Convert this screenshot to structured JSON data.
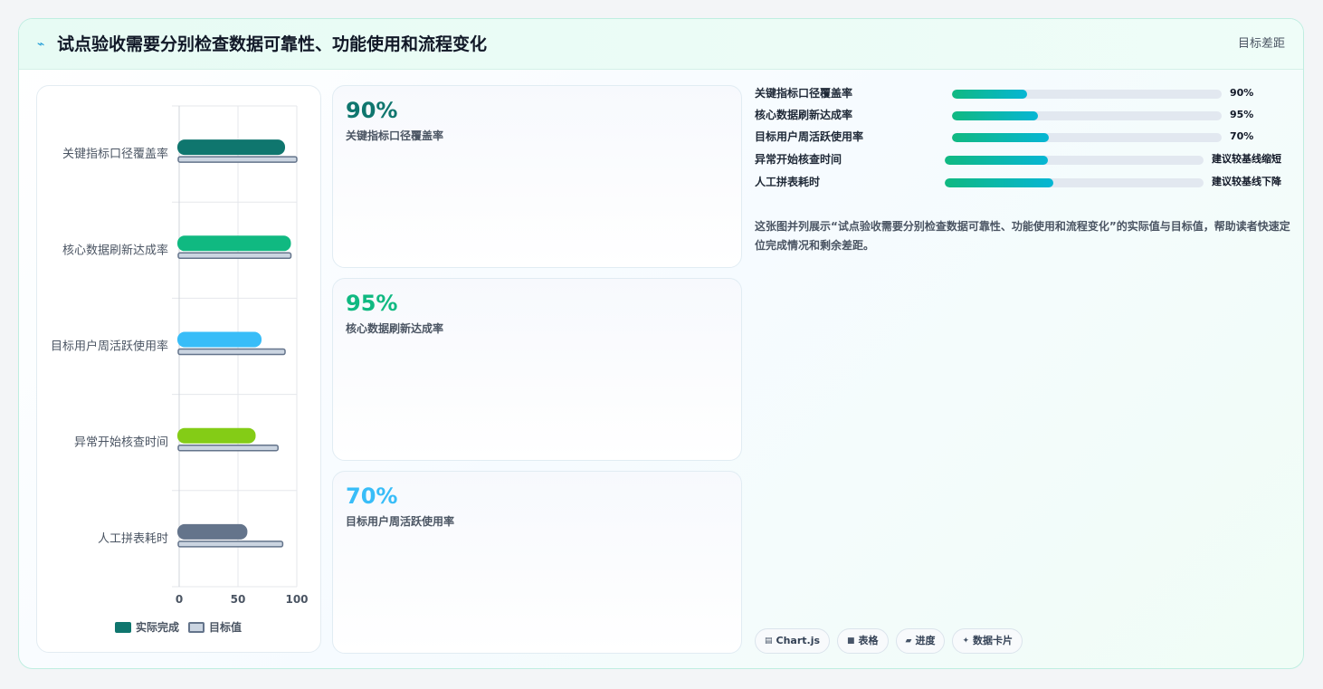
{
  "header": {
    "title": "试点验收需要分别检查数据可靠性、功能使用和流程变化",
    "title_icon": "spark-icon",
    "right_link": "目标差距"
  },
  "chart_data": {
    "type": "bar",
    "orientation": "horizontal",
    "categories": [
      "关键指标口径覆盖率",
      "核心数据刷新达成率",
      "目标用户周活跃使用率",
      "异常开始核查时间",
      "人工拼表耗时"
    ],
    "series": [
      {
        "name": "实际完成",
        "values": [
          90,
          95,
          70,
          65,
          58
        ],
        "colors": [
          "#0f766e",
          "#10b981",
          "#38bdf8",
          "#84cc16",
          "#64748b"
        ]
      },
      {
        "name": "目标值",
        "values": [
          100,
          95,
          90,
          84,
          88
        ],
        "color": "#cbd5e1"
      }
    ],
    "xlim": [
      0,
      100
    ],
    "xticks": [
      "0",
      "50",
      "100"
    ],
    "grid": true,
    "legend": "bottom"
  },
  "kpis": [
    {
      "value": "90%",
      "label": "关键指标口径覆盖率",
      "color": "#0f766e"
    },
    {
      "value": "95%",
      "label": "核心数据刷新达成率",
      "color": "#10b981"
    },
    {
      "value": "70%",
      "label": "目标用户周活跃使用率",
      "color": "#38bdf8"
    }
  ],
  "progress": [
    {
      "label": "关键指标口径覆盖率",
      "value": "90%",
      "fill": 0.28
    },
    {
      "label": "核心数据刷新达成率",
      "value": "95%",
      "fill": 0.32
    },
    {
      "label": "目标用户周活跃使用率",
      "value": "70%",
      "fill": 0.36
    },
    {
      "label": "异常开始核查时间",
      "value": "建议较基线缩短",
      "fill": 0.4
    },
    {
      "label": "人工拼表耗时",
      "value": "建议较基线下降",
      "fill": 0.42
    }
  ],
  "description": "这张图并列展示“试点验收需要分别检查数据可靠性、功能使用和流程变化”的实际值与目标值，帮助读者快速定位完成情况和剩余差距。",
  "chips": [
    {
      "icon": "▤",
      "label": "Chart.js"
    },
    {
      "icon": "■",
      "label": "表格"
    },
    {
      "icon": "▰",
      "label": "进度"
    },
    {
      "icon": "✦",
      "label": "数据卡片"
    }
  ]
}
